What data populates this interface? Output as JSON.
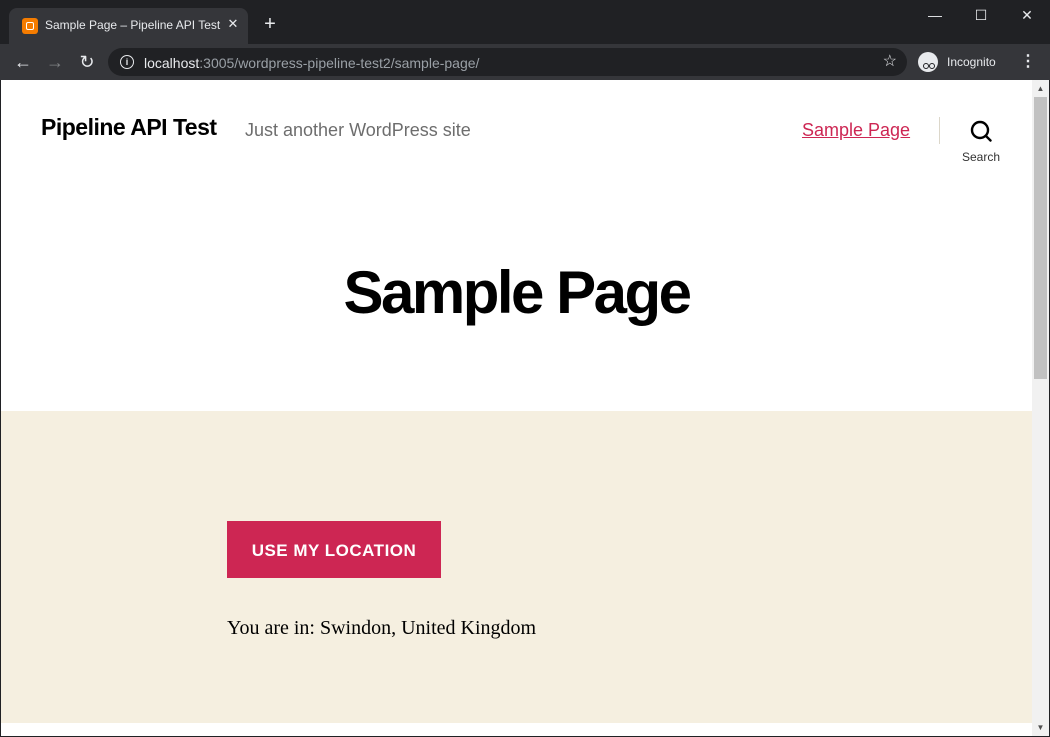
{
  "browser": {
    "tab": {
      "title": "Sample Page – Pipeline API Test",
      "close": "✕"
    },
    "new_tab": "+",
    "window_controls": {
      "minimize": "—",
      "maximize": "☐",
      "close": "✕"
    },
    "address": {
      "host": "localhost",
      "path": ":3005/wordpress-pipeline-test2/sample-page/"
    },
    "nav": {
      "back": "←",
      "forward": "→",
      "reload": "↻"
    },
    "icons": {
      "info": "i",
      "star": "☆",
      "menu": "⋮"
    },
    "incognito_label": "Incognito"
  },
  "site": {
    "title": "Pipeline API Test",
    "description": "Just another WordPress site",
    "menu": [
      {
        "label": "Sample Page"
      }
    ],
    "search_label": "Search",
    "accent_color": "#cd2653",
    "band_color": "#f5efe0"
  },
  "page": {
    "title": "Sample Page",
    "location_button": "USE MY LOCATION",
    "location_prefix": "You are in:",
    "location_value": "Swindon, United Kingdom"
  },
  "scrollbar": {
    "up": "▲",
    "down": "▼"
  }
}
